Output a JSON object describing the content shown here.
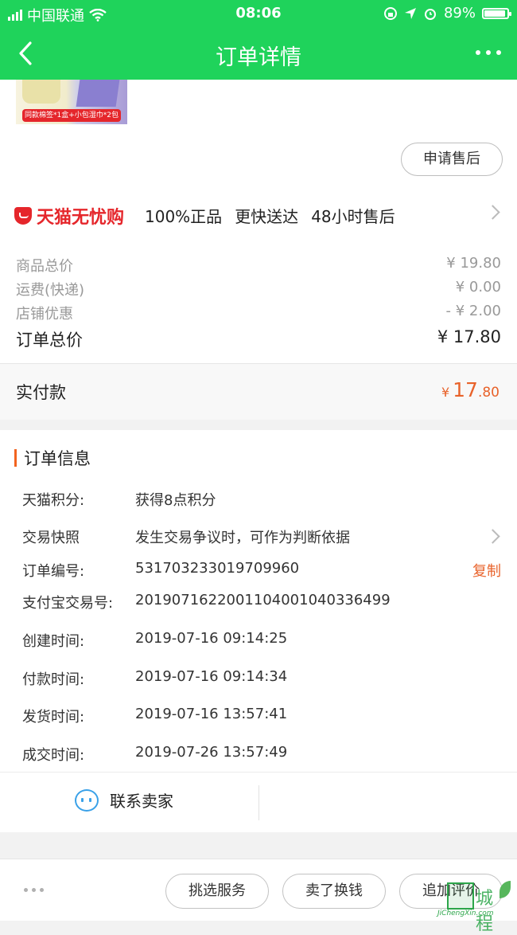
{
  "status_bar": {
    "carrier": "中国联通",
    "time": "08:06",
    "battery_percent": "89%"
  },
  "nav": {
    "title": "订单详情"
  },
  "product": {
    "tag_text": "同款棉签*1盒+小包湿巾*2包"
  },
  "buttons": {
    "apply_after_sale": "申请售后"
  },
  "guarantee": {
    "brand": "天猫无忧购",
    "features": [
      "100%正品",
      "更快送达",
      "48小时售后"
    ]
  },
  "prices": {
    "rows": [
      {
        "label": "商品总价",
        "value": "¥ 19.80"
      },
      {
        "label": "运费(快递)",
        "value": "¥ 0.00"
      },
      {
        "label": "店铺优惠",
        "value": "- ¥ 2.00"
      }
    ],
    "total_label": "订单总价",
    "total_value": "¥ 17.80"
  },
  "paid": {
    "label": "实付款",
    "currency": "¥",
    "integer": "17",
    "decimal": ".80"
  },
  "order_info": {
    "title": "订单信息",
    "rows": [
      {
        "key": "天猫积分:",
        "value": "获得8点积分"
      },
      {
        "key": "交易快照",
        "value": "发生交易争议时，可作为判断依据"
      },
      {
        "key": "订单编号:",
        "value": "531703233019709960"
      },
      {
        "key": "支付宝交易号:",
        "value": "2019071622001104001040336499"
      },
      {
        "key": "创建时间:",
        "value": "2019-07-16 09:14:25"
      },
      {
        "key": "付款时间:",
        "value": "2019-07-16 09:14:34"
      },
      {
        "key": "发货时间:",
        "value": "2019-07-16 13:57:41"
      },
      {
        "key": "成交时间:",
        "value": "2019-07-26 13:57:49"
      }
    ],
    "copy_label": "复制"
  },
  "contact": {
    "label": "联系卖家"
  },
  "bottom_bar": {
    "buttons": [
      "挑选服务",
      "卖了换钱",
      "追加评价"
    ]
  },
  "watermark": {
    "text": "城 程",
    "domain": "JiChengXin.com"
  },
  "colors": {
    "header_green": "#1fd35b",
    "accent_orange": "#e8622a",
    "tmall_red": "#e5262b"
  }
}
